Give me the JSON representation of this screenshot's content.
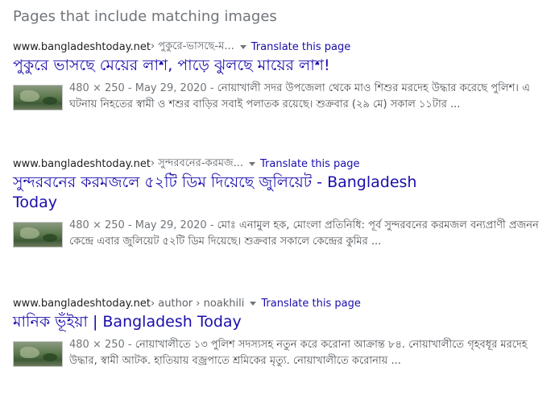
{
  "section_heading": "Pages that include matching images",
  "results": [
    {
      "site": "www.bangladeshtoday.net",
      "breadcrumb": " › পুকুরে-ভাসছে-ম...",
      "translate": "Translate this page",
      "title": "পুকুরে ভাসছে মেয়ের লাশ, পাড়ে ঝুলছে মায়ের লাশ!",
      "meta": "480 × 250 - May 29, 2020 - ",
      "snippet": "নোয়াখালী সদর উপজেলা থেকে মাও শিশুর মরদেহ উদ্ধার করেছে পুলিশ। এ ঘটনায় নিহতের স্বামী ও শশুর বাড়ির সবাই পলাতক রয়েছে। শুক্রবার (২৯ মে) সকাল ১১টার ..."
    },
    {
      "site": "www.bangladeshtoday.net",
      "breadcrumb": " › সুন্দরবনের-করমজ...",
      "translate": "Translate this page",
      "title": "সুন্দরবনের করমজলে ৫২টি ডিম দিয়েছে জুলিয়েট - Bangladesh Today",
      "meta": "480 × 250 - May 29, 2020 - ",
      "snippet": "মোঃ এনামুল হক, মোংলা প্রতিনিধি: পূর্ব সুন্দরবনের করমজল বন্যপ্রাণী প্রজনন কেন্দ্রে এবার জুলিয়েট ৫২টি ডিম দিয়েছে। শুক্রবার সকালে কেন্দ্রের কুমির ..."
    },
    {
      "site": "www.bangladeshtoday.net",
      "breadcrumb": " › author › noakhili",
      "translate": "Translate this page",
      "title": "মানিক ভূঁইয়া | Bangladesh Today",
      "meta": "480 × 250 - ",
      "snippet": "নোয়াখালীতে ১৩ পুলিশ সদস্যসহ নতুন করে করোনা আক্রান্ত ৮৪. নোয়াখালীতে গৃহবধূর মরদেহ উদ্ধার, স্বামী আটক. হাতিয়ায় বজ্রপাতে শ্রমিকের মৃত্যু. নোয়াখালীতে করোনায় ..."
    }
  ]
}
